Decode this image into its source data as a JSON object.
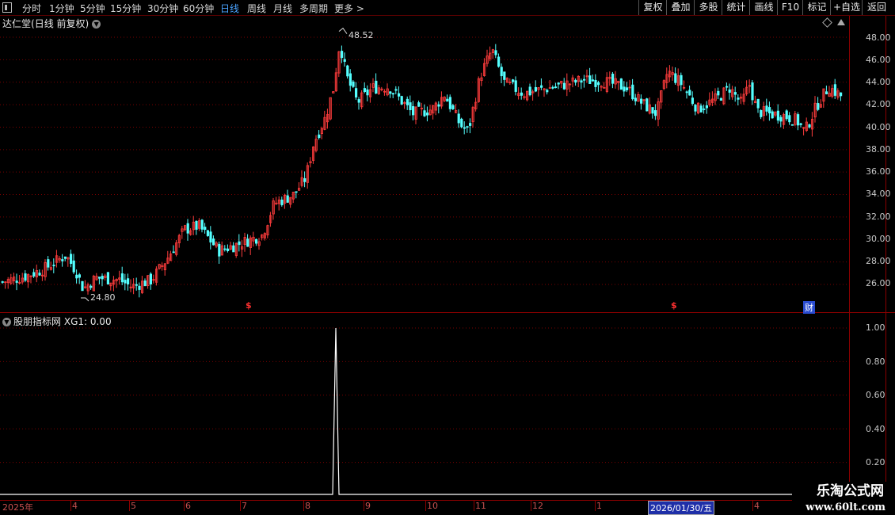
{
  "toolbar": {
    "periods": [
      "分时",
      "1分钟",
      "5分钟",
      "15分钟",
      "30分钟",
      "60分钟",
      "日线",
      "周线",
      "月线",
      "多周期",
      "更多 >"
    ],
    "active_period": "日线",
    "right_buttons": [
      "复权",
      "叠加",
      "多股",
      "统计",
      "画线",
      "F10",
      "标记",
      "+自选",
      "返回"
    ]
  },
  "main_chart": {
    "stock_name": "达仁堂",
    "mode": "(日线 前复权)",
    "y_axis_labels": [
      "48.00",
      "46.00",
      "44.00",
      "42.00",
      "40.00",
      "38.00",
      "36.00",
      "34.00",
      "32.00",
      "30.00",
      "28.00",
      "26.00"
    ],
    "high_annotation": "48.52",
    "low_annotation": "24.80",
    "signal_marks": [
      "$",
      "$"
    ],
    "finance_tag": "财"
  },
  "indicator": {
    "title": "股朋指标网",
    "series_label": "XG1: 0.00",
    "y_axis_labels": [
      "1.00",
      "0.80",
      "0.60",
      "0.40",
      "0.20"
    ]
  },
  "x_axis": {
    "labels": [
      "2025年",
      "4",
      "5",
      "6",
      "7",
      "8",
      "9",
      "10",
      "11",
      "12",
      "1",
      "4"
    ],
    "cursor_date": "2026/01/30/五"
  },
  "watermark": {
    "name": "乐淘公式网",
    "url": "www.60lt.com"
  },
  "colors": {
    "up": "#ff3c3c",
    "down": "#54ffff",
    "border": "#8a0000",
    "active": "#4aa3ff"
  },
  "chart_data": {
    "type": "candlestick",
    "y_range": [
      24.0,
      49.5
    ],
    "high": 48.52,
    "low": 24.8,
    "indicator_series": {
      "name": "XG1",
      "current_value": 0.0,
      "y_range": [
        0,
        1.0
      ]
    }
  }
}
